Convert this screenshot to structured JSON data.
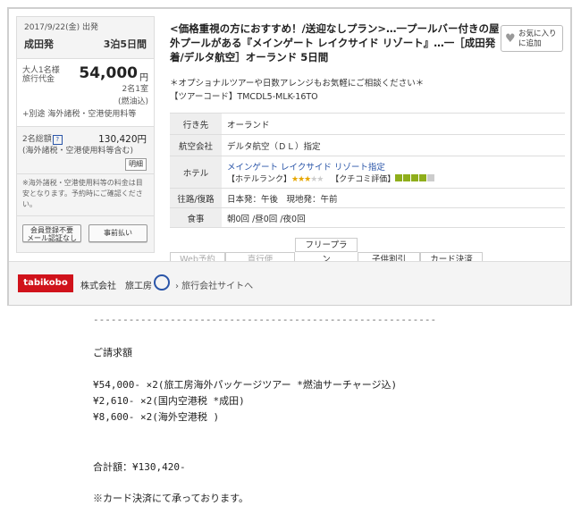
{
  "left": {
    "date": "2017/9/22(金) 出発",
    "origin": "成田発",
    "nights": "3泊5日間",
    "adult_label1": "大人1名様",
    "adult_label2": "旅行代金",
    "price": "54,000",
    "yen": "円",
    "occupancy": "2名1室",
    "fuel": "(燃油込)",
    "extra": "+別途 海外諸税・空港使用料等",
    "total_label": "2名総額",
    "total_price": "130,420円",
    "total_note": "(海外諸税・空港使用料等含む)",
    "detail_btn": "明細",
    "notice": "※海外諸税・空港使用料等の料金は目安となります。予約時にご確認ください。",
    "register_btn": "会員登録不要\nメール認証なし",
    "prepay_btn": "事前払い"
  },
  "right": {
    "title": "<価格重視の方におすすめ！/送迎なしプラン>…一プールバー付きの屋外プールがある『メインゲート レイクサイド リゾート』…一［成田発着/デルタ航空］オーランド 5日間",
    "fav_line1": "お気に入り",
    "fav_line2": "に追加",
    "desc_line1": "＊オプショナルツアーや日数アレンジもお気軽にご相談ください＊",
    "desc_line2": "【ツアーコード】TMCDL5-MLK-16TO",
    "rows": [
      {
        "label": "行き先",
        "value": "オーランド"
      },
      {
        "label": "航空会社",
        "value": "デルタ航空（ＤＬ）指定"
      },
      {
        "label": "ホテル",
        "value": "メインゲート レイクサイド リゾート指定",
        "rank_label": "【ホテルランク】",
        "review_label": "【クチコミ評価】"
      },
      {
        "label": "往路/復路",
        "value": "日本発：午後　現地発：午前"
      },
      {
        "label": "食事",
        "value": "朝0回 /昼0回 /夜0回"
      }
    ],
    "tags": [
      "Web予約",
      "直行便",
      "フリープラン",
      "子供割引",
      "カード決済"
    ]
  },
  "footer": {
    "logo": "tabikobo",
    "company": "株式会社　旅工房",
    "link": "› 旅行会社サイトへ"
  },
  "body": {
    "divider": "----------------------------------------------------------",
    "heading": "ご請求額",
    "line1": "¥54,000- ×2(旅工房海外パッケージツアー *燃油サーチャージ込)",
    "line2": "¥2,610- ×2(国内空港税 *成田)",
    "line3": "¥8,600- ×2(海外空港税 )",
    "total": "合計額：¥130,420-",
    "note": "※カード決済にて承っております。"
  },
  "colors": {
    "accent_red": "#d0121b",
    "link_blue": "#2a55a8",
    "star": "#e6a600",
    "review_green": "#8fae1b"
  }
}
